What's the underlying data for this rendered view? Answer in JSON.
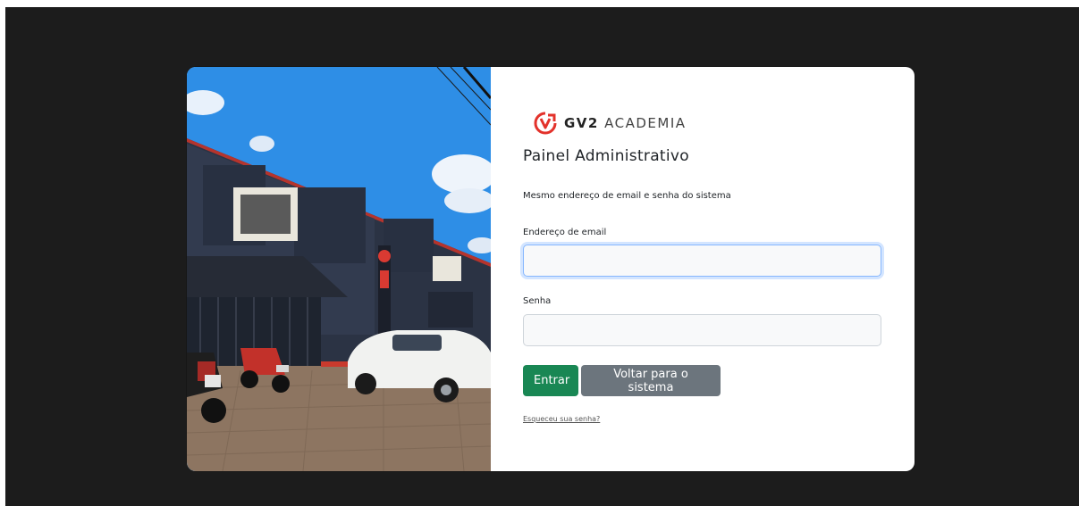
{
  "brand": {
    "strong": "GV2",
    "rest": "ACADEMIA",
    "accent_color": "#e3322b"
  },
  "login": {
    "title": "Painel Administrativo",
    "subtitle": "Mesmo endereço de email e senha do sistema",
    "email_label": "Endereço de email",
    "email_value": "",
    "password_label": "Senha",
    "password_value": "",
    "submit_label": "Entrar",
    "back_label": "Voltar para o sistema",
    "forgot_label": "Esqueceu sua senha?"
  },
  "colors": {
    "primary": "#198754",
    "secondary": "#6c757d",
    "backdrop": "#1c1c1c",
    "focus_border": "#86b7fe"
  }
}
